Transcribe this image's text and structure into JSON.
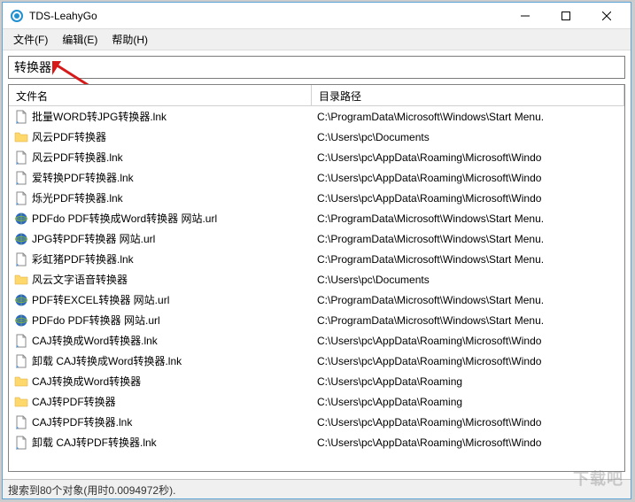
{
  "window": {
    "title": "TDS-LeahyGo"
  },
  "menubar": {
    "file": "文件(F)",
    "edit": "编辑(E)",
    "help": "帮助(H)"
  },
  "search": {
    "value": "转换器",
    "placeholder": ""
  },
  "columns": {
    "name": "文件名",
    "path": "目录路径"
  },
  "icons": {
    "lnk": "link-file",
    "folder": "folder",
    "url": "url-shortcut"
  },
  "items": [
    {
      "icon": "lnk",
      "name": "批量WORD转JPG转换器.lnk",
      "path": "C:\\ProgramData\\Microsoft\\Windows\\Start Menu."
    },
    {
      "icon": "folder",
      "name": "风云PDF转换器",
      "path": "C:\\Users\\pc\\Documents"
    },
    {
      "icon": "lnk",
      "name": "风云PDF转换器.lnk",
      "path": "C:\\Users\\pc\\AppData\\Roaming\\Microsoft\\Windo"
    },
    {
      "icon": "lnk",
      "name": "爱转换PDF转换器.lnk",
      "path": "C:\\Users\\pc\\AppData\\Roaming\\Microsoft\\Windo"
    },
    {
      "icon": "lnk",
      "name": "烁光PDF转换器.lnk",
      "path": "C:\\Users\\pc\\AppData\\Roaming\\Microsoft\\Windo"
    },
    {
      "icon": "url",
      "name": "PDFdo PDF转换成Word转换器 网站.url",
      "path": "C:\\ProgramData\\Microsoft\\Windows\\Start Menu."
    },
    {
      "icon": "url",
      "name": "JPG转PDF转换器 网站.url",
      "path": "C:\\ProgramData\\Microsoft\\Windows\\Start Menu."
    },
    {
      "icon": "lnk",
      "name": "彩虹猪PDF转换器.lnk",
      "path": "C:\\ProgramData\\Microsoft\\Windows\\Start Menu."
    },
    {
      "icon": "folder",
      "name": "风云文字语音转换器",
      "path": "C:\\Users\\pc\\Documents"
    },
    {
      "icon": "url",
      "name": "PDF转EXCEL转换器 网站.url",
      "path": "C:\\ProgramData\\Microsoft\\Windows\\Start Menu."
    },
    {
      "icon": "url",
      "name": "PDFdo PDF转换器 网站.url",
      "path": "C:\\ProgramData\\Microsoft\\Windows\\Start Menu."
    },
    {
      "icon": "lnk",
      "name": "CAJ转换成Word转换器.lnk",
      "path": "C:\\Users\\pc\\AppData\\Roaming\\Microsoft\\Windo"
    },
    {
      "icon": "lnk",
      "name": "卸载 CAJ转换成Word转换器.lnk",
      "path": "C:\\Users\\pc\\AppData\\Roaming\\Microsoft\\Windo"
    },
    {
      "icon": "folder",
      "name": "CAJ转换成Word转换器",
      "path": "C:\\Users\\pc\\AppData\\Roaming"
    },
    {
      "icon": "folder",
      "name": "CAJ转PDF转换器",
      "path": "C:\\Users\\pc\\AppData\\Roaming"
    },
    {
      "icon": "lnk",
      "name": "CAJ转PDF转换器.lnk",
      "path": "C:\\Users\\pc\\AppData\\Roaming\\Microsoft\\Windo"
    },
    {
      "icon": "lnk",
      "name": "卸载 CAJ转PDF转换器.lnk",
      "path": "C:\\Users\\pc\\AppData\\Roaming\\Microsoft\\Windo"
    }
  ],
  "statusbar": {
    "text": "搜索到80个对象(用时0.0094972秒)."
  },
  "watermark": "下载吧"
}
